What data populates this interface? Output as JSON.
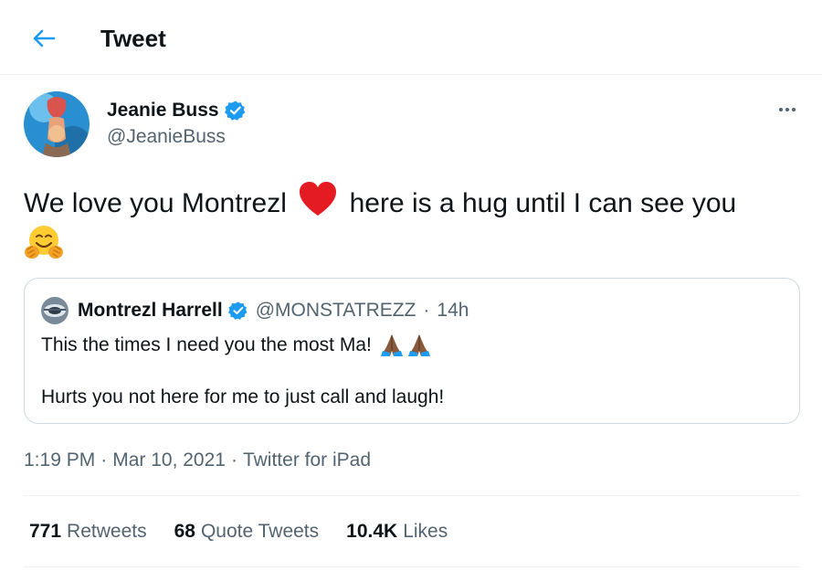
{
  "header": {
    "title": "Tweet"
  },
  "author": {
    "name": "Jeanie Buss",
    "handle": "@JeanieBuss",
    "verified": true
  },
  "tweet": {
    "text_part1": "We love you Montrezl",
    "text_part2": "here is a hug until I can see you",
    "emoji_1": "red-heart",
    "emoji_2": "hugging-face"
  },
  "quote": {
    "name": "Montrezl Harrell",
    "handle": "@MONSTATREZZ",
    "separator": "·",
    "time": "14h",
    "line1": "This the times I need you the most Ma!",
    "line1_emoji": "folded-hands",
    "line2": "Hurts you not here for me to just call and laugh!"
  },
  "meta": {
    "time": "1:19 PM",
    "separator": "·",
    "date": "Mar 10, 2021",
    "source": "Twitter for iPad"
  },
  "stats": [
    {
      "count": "771",
      "label": "Retweets"
    },
    {
      "count": "68",
      "label": "Quote Tweets"
    },
    {
      "count": "10.4K",
      "label": "Likes"
    }
  ],
  "colors": {
    "accent": "#1d9bf0",
    "text": "#0f1419",
    "secondary": "#536471",
    "border": "#cfd9de"
  }
}
